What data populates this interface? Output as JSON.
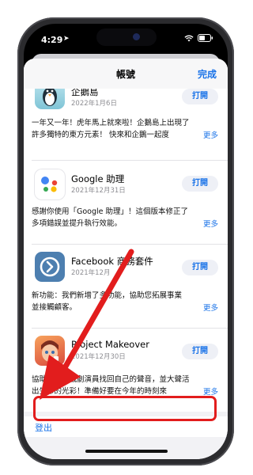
{
  "status_bar": {
    "time": "4:29",
    "location_icon": "location-arrow-icon",
    "wifi_icon": "wifi-icon",
    "battery_icon": "battery-icon"
  },
  "nav": {
    "title": "帳號",
    "done_label": "完成"
  },
  "apps": [
    {
      "name": "企鵝島",
      "date": "2022年1月6日",
      "open_label": "打開",
      "desc_line1": "一年又一年！虎年馬上就來啦！企鵝島上出現了",
      "desc_line2": "許多獨特的東方元素！ 快來和企鵝一起度",
      "more_label": "更多"
    },
    {
      "name": "Google 助理",
      "date": "2021年12月31日",
      "open_label": "打開",
      "desc_line1": "感謝你使用「Google 助理」！這個版本修正了",
      "desc_line2": "多項錯誤並提升執行效能。",
      "more_label": "更多"
    },
    {
      "name": "Facebook 商務套件",
      "date": "2021年12月",
      "open_label": "打開",
      "desc_line1": "新功能：我們新增了多功能，協助您拓展事業",
      "desc_line2": "並接觸顧客。",
      "more_label": "更多"
    },
    {
      "name": "Project Makeover",
      "date": "2021年12月30日",
      "open_label": "打開",
      "desc_line1": "協助燒鍋的戲劇演員找回自己的聲音，並大聲活",
      "desc_line2": "出生命的光彩！準備好要在今年的時刻來",
      "more_label": "更多"
    }
  ],
  "sign_out": {
    "label": "登出"
  },
  "colors": {
    "accent": "#1a73e8",
    "highlight": "#e21d1d"
  }
}
